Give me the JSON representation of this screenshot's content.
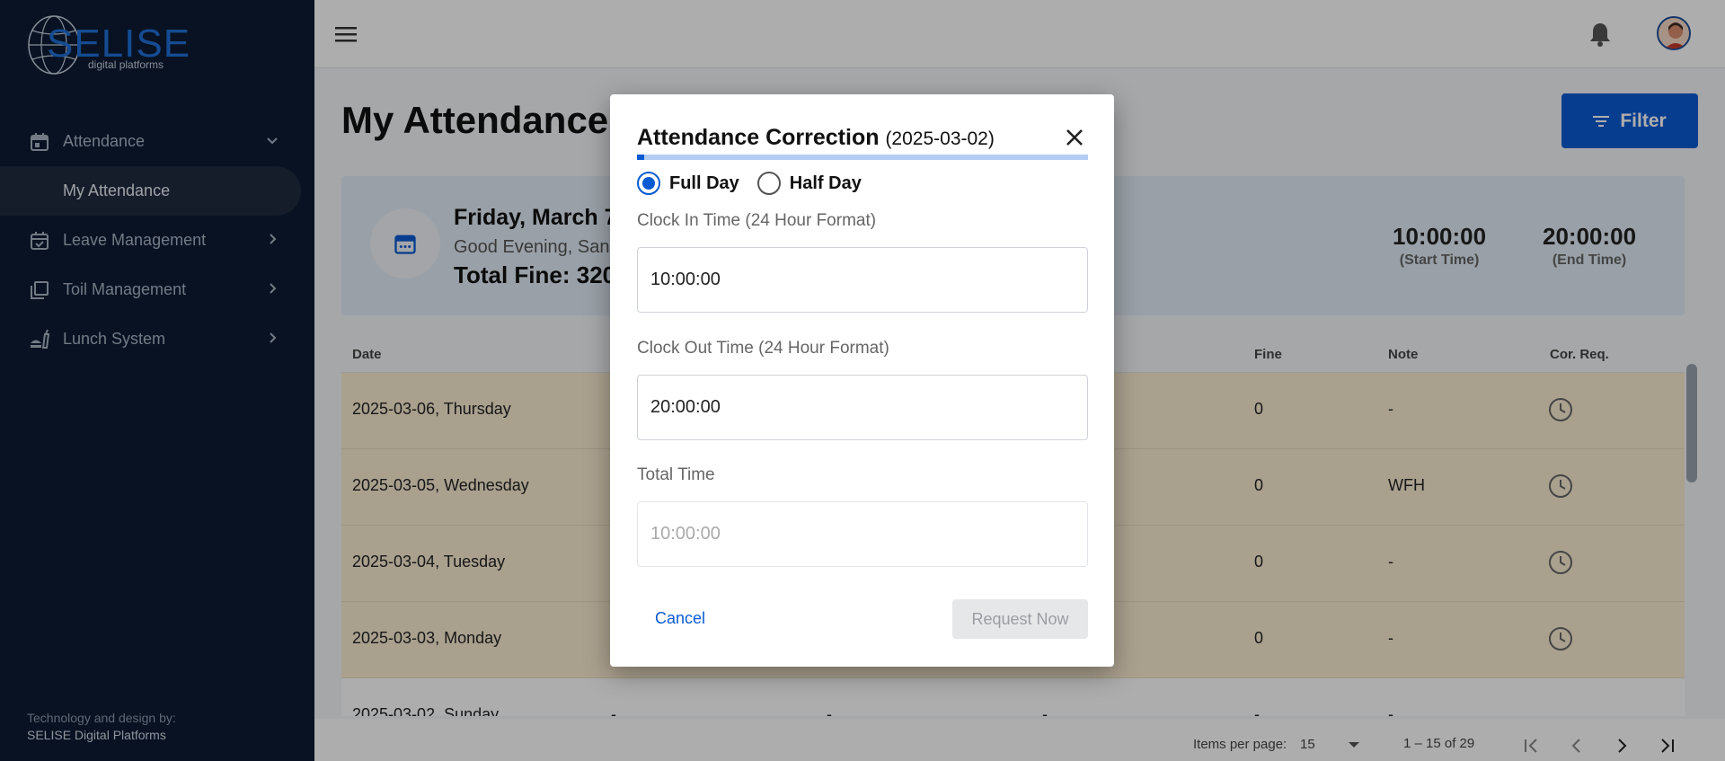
{
  "sidebar": {
    "logo_text": "SELISE",
    "logo_sub": "digital platforms",
    "items": [
      {
        "label": "Attendance",
        "icon": "calendar-icon"
      },
      {
        "label": "My Attendance"
      },
      {
        "label": "Leave Management",
        "icon": "calendar-check-icon"
      },
      {
        "label": "Toil Management",
        "icon": "library-icon"
      },
      {
        "label": "Lunch System",
        "icon": "fastfood-icon"
      }
    ],
    "credit_line1": "Technology and design by:",
    "credit_line2": "SELISE Digital Platforms"
  },
  "page": {
    "title": "My Attendance",
    "filter_label": "Filter"
  },
  "summary": {
    "date": "Friday, March 7",
    "greeting": "Good Evening, San",
    "total_fine": "Total Fine: 320",
    "start_time": "10:00:00",
    "start_label": "(Start Time)",
    "end_time": "20:00:00",
    "end_label": "(End Time)"
  },
  "table": {
    "headers": {
      "date": "Date",
      "fine": "Fine",
      "note": "Note",
      "corr": "Cor. Req."
    },
    "rows": [
      {
        "date": "2025-03-06, Thursday",
        "fine": "0",
        "note": "-"
      },
      {
        "date": "2025-03-05, Wednesday",
        "fine": "0",
        "note": "WFH"
      },
      {
        "date": "2025-03-04, Tuesday",
        "fine": "0",
        "note": "-"
      },
      {
        "date": "2025-03-03, Monday",
        "fine": "0",
        "note": "-"
      },
      {
        "date": "2025-03-02, Sunday",
        "col2": "-",
        "col3": "-",
        "col4": "-",
        "fine": "-",
        "note": "-"
      }
    ]
  },
  "paginator": {
    "items_per_page_label": "Items per page:",
    "items_per_page": "15",
    "range": "1 – 15 of 29"
  },
  "dialog": {
    "title": "Attendance Correction",
    "title_date": "(2025-03-02)",
    "progress": 0.015,
    "full_day_label": "Full Day",
    "half_day_label": "Half Day",
    "selected": "Full Day",
    "clock_in_label": "Clock In Time (24 Hour Format)",
    "clock_in_value": "10:00:00",
    "clock_out_label": "Clock Out Time (24 Hour Format)",
    "clock_out_value": "20:00:00",
    "total_label": "Total Time",
    "total_value": "10:00:00",
    "cancel_label": "Cancel",
    "request_label": "Request Now"
  },
  "colors": {
    "sidebar_bg": "#0d1b33",
    "accent": "#0a5bd3",
    "row_highlight": "#fbecd2"
  }
}
